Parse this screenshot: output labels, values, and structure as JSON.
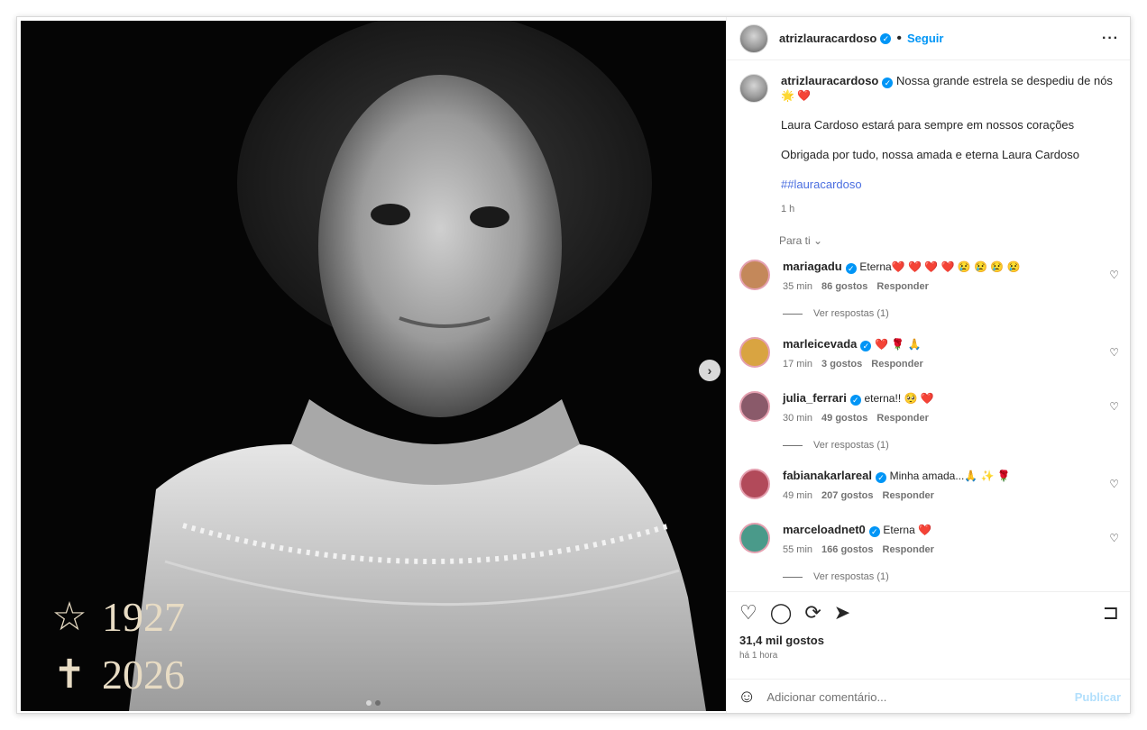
{
  "post": {
    "username": "atrizlauracardoso",
    "follow_label": "Seguir",
    "more_icon": "more-horizontal-icon",
    "photo": {
      "birth_year": "1927",
      "death_year": "2026",
      "birth_glyph": "☆",
      "death_glyph": "✝"
    },
    "caption": {
      "text": "Nossa grande estrela se despediu de nós",
      "emojis": "🌟 ❤️",
      "line2": "Laura Cardoso estará para sempre em nossos corações",
      "line3": "Obrigada por tudo, nossa amada e eterna Laura Cardoso",
      "hashtag": "##lauracardoso",
      "time": "1 h"
    },
    "for_you_label": "Para ti",
    "comments": [
      {
        "username": "mariagadu",
        "text": "Eterna❤️ ❤️ ❤️ ❤️ 😢 😢 😢 😢",
        "time": "35 min",
        "likes": "86 gostos",
        "reply": "Responder",
        "replies": "Ver respostas (1)",
        "avatar_color": "#c4885a"
      },
      {
        "username": "marleicevada",
        "text": "❤️ 🌹 🙏",
        "time": "17 min",
        "likes": "3 gostos",
        "reply": "Responder",
        "replies": "",
        "avatar_color": "#d9a441"
      },
      {
        "username": "julia_ferrari",
        "text": "eterna!! 🥺 ❤️",
        "time": "30 min",
        "likes": "49 gostos",
        "reply": "Responder",
        "replies": "Ver respostas (1)",
        "avatar_color": "#8a5a6a"
      },
      {
        "username": "fabianakarlareal",
        "text": "Minha amada...🙏 ✨ 🌹",
        "time": "49 min",
        "likes": "207 gostos",
        "reply": "Responder",
        "replies": "",
        "avatar_color": "#b24a5a"
      },
      {
        "username": "marceloadnet0",
        "text": "Eterna ❤️",
        "time": "55 min",
        "likes": "166 gostos",
        "reply": "Responder",
        "replies": "Ver respostas (1)",
        "avatar_color": "#4a9a8a"
      }
    ],
    "likes_total": "31,4 mil gostos",
    "posted_ago": "há 1 hora",
    "add_comment_placeholder": "Adicionar comentário...",
    "publish_label": "Publicar"
  }
}
